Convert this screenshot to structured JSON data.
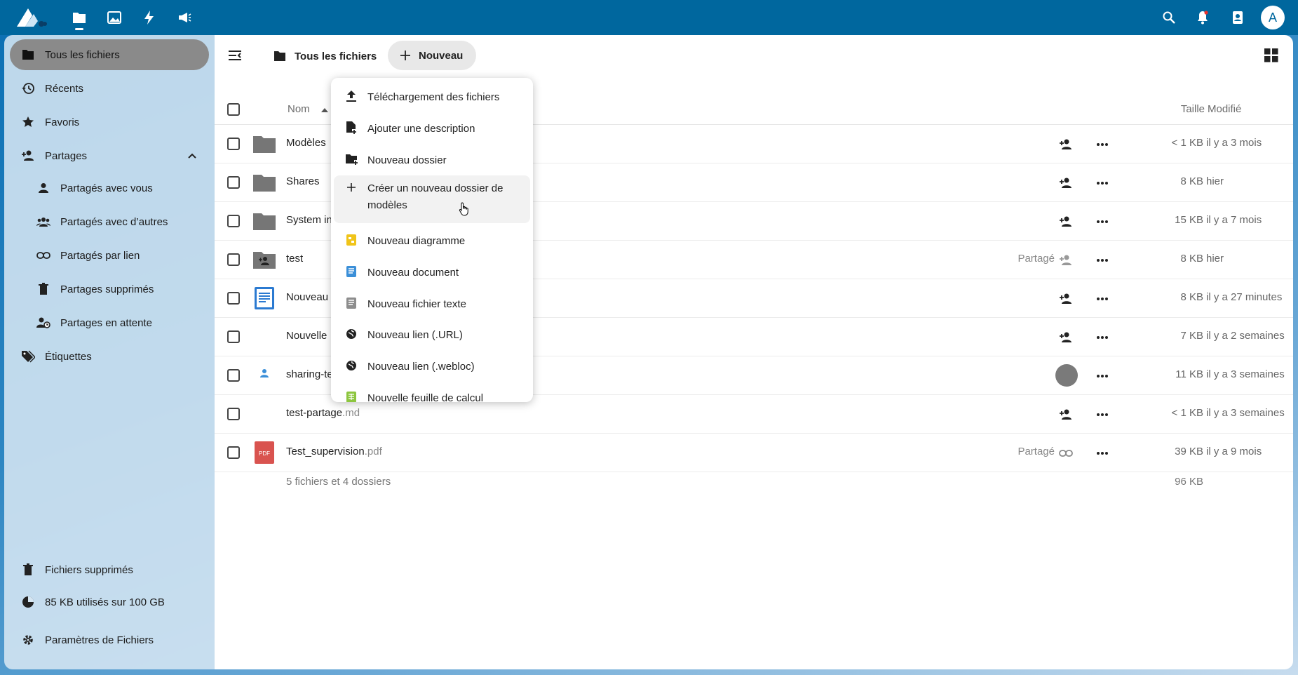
{
  "header": {
    "apps": [
      "files-icon",
      "photos-icon",
      "activity-icon",
      "announcements-icon"
    ],
    "avatar_letter": "A"
  },
  "sidebar": {
    "items": [
      {
        "label": "Tous les fichiers",
        "icon": "folder-icon"
      },
      {
        "label": "Récents",
        "icon": "history-icon"
      },
      {
        "label": "Favoris",
        "icon": "star-icon"
      },
      {
        "label": "Partages",
        "icon": "share-icon"
      },
      {
        "label": "Partagés avec vous",
        "icon": "user-icon"
      },
      {
        "label": "Partagés avec d’autres",
        "icon": "users-icon"
      },
      {
        "label": "Partagés par lien",
        "icon": "link-icon"
      },
      {
        "label": "Partages supprimés",
        "icon": "trash-icon"
      },
      {
        "label": "Partages en attente",
        "icon": "pending-icon"
      },
      {
        "label": "Étiquettes",
        "icon": "tag-icon"
      }
    ],
    "bottom": {
      "trash": "Fichiers supprimés",
      "quota": "85 KB utilisés sur 100 GB",
      "settings": "Paramètres de Fichiers"
    }
  },
  "breadcrumb": {
    "current": "Tous les fichiers",
    "new_button": "Nouveau"
  },
  "table": {
    "headers": {
      "name": "Nom",
      "size": "Taille",
      "modified": "Modifié"
    },
    "rows": [
      {
        "name": "Modèles",
        "ext": "",
        "shared": "",
        "size": "< 1 KB",
        "modified": "il y a 3 mois",
        "type": "folder"
      },
      {
        "name": "Shares",
        "ext": "",
        "shared": "",
        "size": "8 KB",
        "modified": "hier",
        "type": "folder"
      },
      {
        "name": "System in",
        "ext": "",
        "shared": "",
        "size": "15 KB",
        "modified": "il y a 7 mois",
        "type": "folder"
      },
      {
        "name": "test",
        "ext": "",
        "shared": "Partagé",
        "size": "8 KB",
        "modified": "hier",
        "type": "shared-folder"
      },
      {
        "name": "Nouveau",
        "ext": "",
        "shared": "",
        "size": "8 KB",
        "modified": "il y a 27 minutes",
        "type": "document"
      },
      {
        "name": "Nouvelle",
        "ext": "",
        "shared": "",
        "size": "7 KB",
        "modified": "il y a 2 semaines",
        "type": "blank"
      },
      {
        "name": "sharing-te",
        "ext": "",
        "shared": "",
        "size": "11 KB",
        "modified": "il y a 3 semaines",
        "type": "user-file"
      },
      {
        "name": "test-partage",
        "ext": ".md",
        "shared": "",
        "size": "< 1 KB",
        "modified": "il y a 3 semaines",
        "type": "blank"
      },
      {
        "name": "Test_supervision",
        "ext": ".pdf",
        "shared": "Partagé",
        "size": "39 KB",
        "modified": "il y a 9 mois",
        "type": "pdf"
      }
    ],
    "summary": "5 fichiers et 4 dossiers",
    "total_size": "96 KB"
  },
  "new_menu": {
    "items": [
      {
        "label": "Téléchargement des fichiers",
        "icon": "upload-icon"
      },
      {
        "label": "Ajouter une description",
        "icon": "file-plus-icon"
      },
      {
        "label": "Nouveau dossier",
        "icon": "folder-plus-icon"
      },
      {
        "label": "Créer un nouveau dossier de modèles",
        "icon": "plus-icon"
      },
      {
        "label": "Nouveau diagramme",
        "icon": "diagram-icon"
      },
      {
        "label": "Nouveau document",
        "icon": "document-icon"
      },
      {
        "label": "Nouveau fichier texte",
        "icon": "text-file-icon"
      },
      {
        "label": "Nouveau lien (.URL)",
        "icon": "globe-icon"
      },
      {
        "label": "Nouveau lien (.webloc)",
        "icon": "globe-icon"
      },
      {
        "label": "Nouvelle feuille de calcul",
        "icon": "spreadsheet-icon"
      }
    ]
  },
  "pdf_badge": "PDF",
  "colors": {
    "header": "#00679e",
    "active_nav": "#8a8a8a",
    "folder": "#767676"
  }
}
